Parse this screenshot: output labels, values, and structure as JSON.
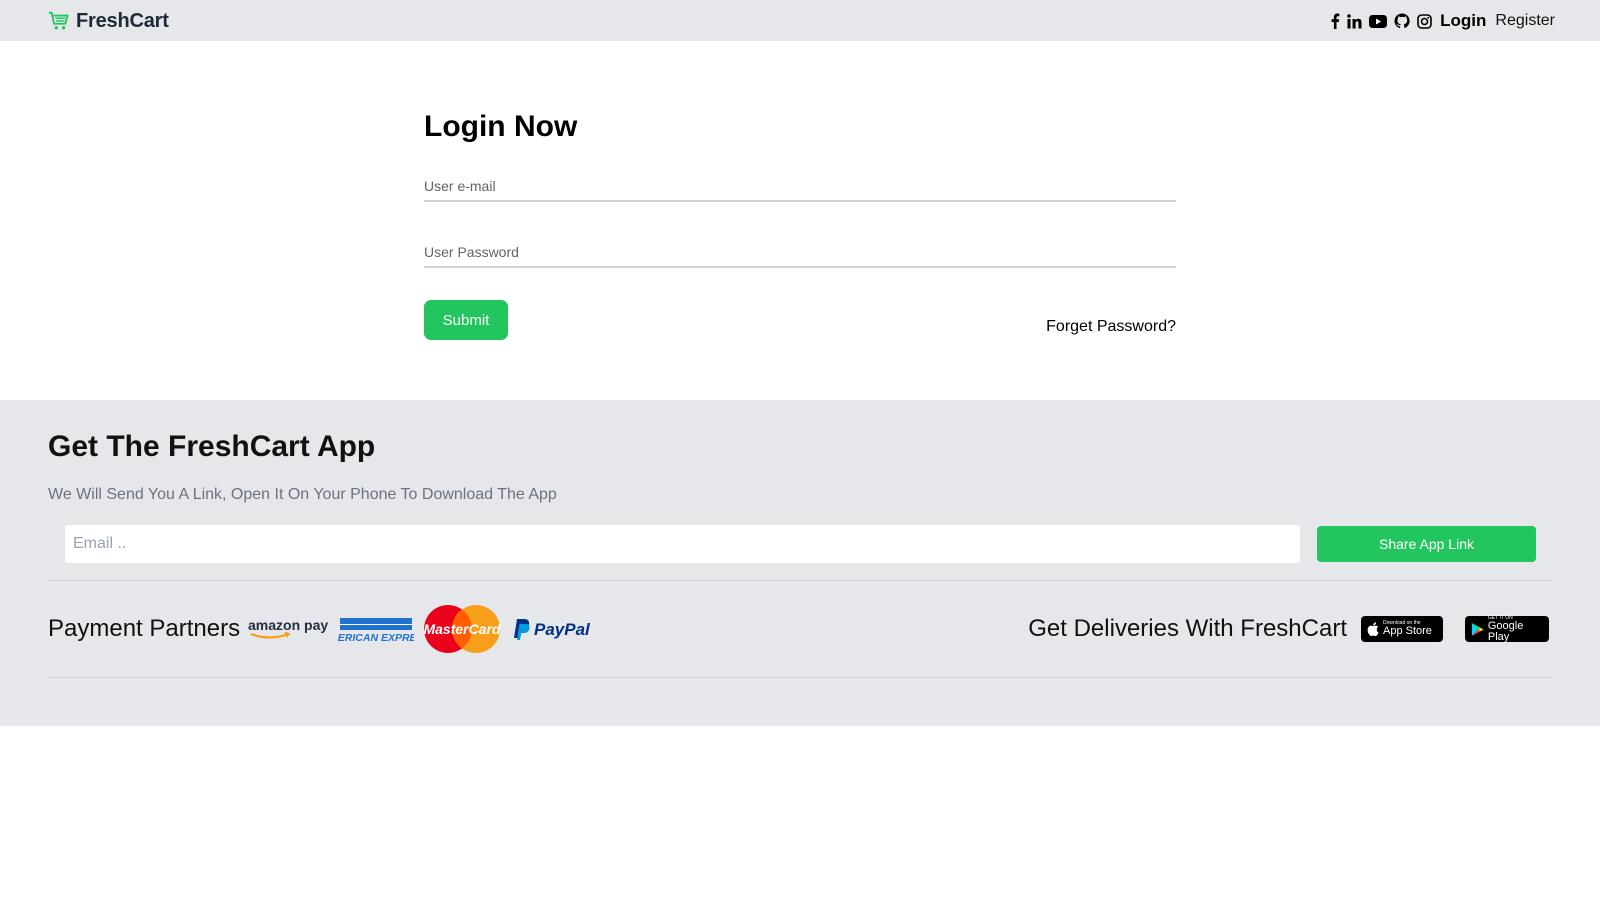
{
  "navbar": {
    "brand": "FreshCart",
    "social_icons": [
      "facebook-icon",
      "linkedin-icon",
      "youtube-icon",
      "github-icon",
      "instagram-icon"
    ],
    "login": "Login",
    "register": "Register"
  },
  "login": {
    "title": "Login Now",
    "email_placeholder": "User e-mail",
    "password_placeholder": "User Password",
    "submit": "Submit",
    "forget": "Forget Password?"
  },
  "footer": {
    "title": "Get The FreshCart App",
    "subtitle": "We Will Send You A Link, Open It On Your Phone To Download The App",
    "email_placeholder": "Email ..",
    "share_button": "Share App Link",
    "payment_label": "Payment Partners",
    "payment_partners": [
      "amazon pay",
      "AMERICAN EXPRESS",
      "MasterCard",
      "PayPal"
    ],
    "deliveries_label": "Get Deliveries With FreshCart",
    "app_store": {
      "small": "Download on the",
      "big": "App Store"
    },
    "google_play": {
      "small": "GET IT ON",
      "big": "Google Play"
    }
  },
  "colors": {
    "accent": "#22c55e",
    "bar_bg": "#e5e7eb"
  }
}
